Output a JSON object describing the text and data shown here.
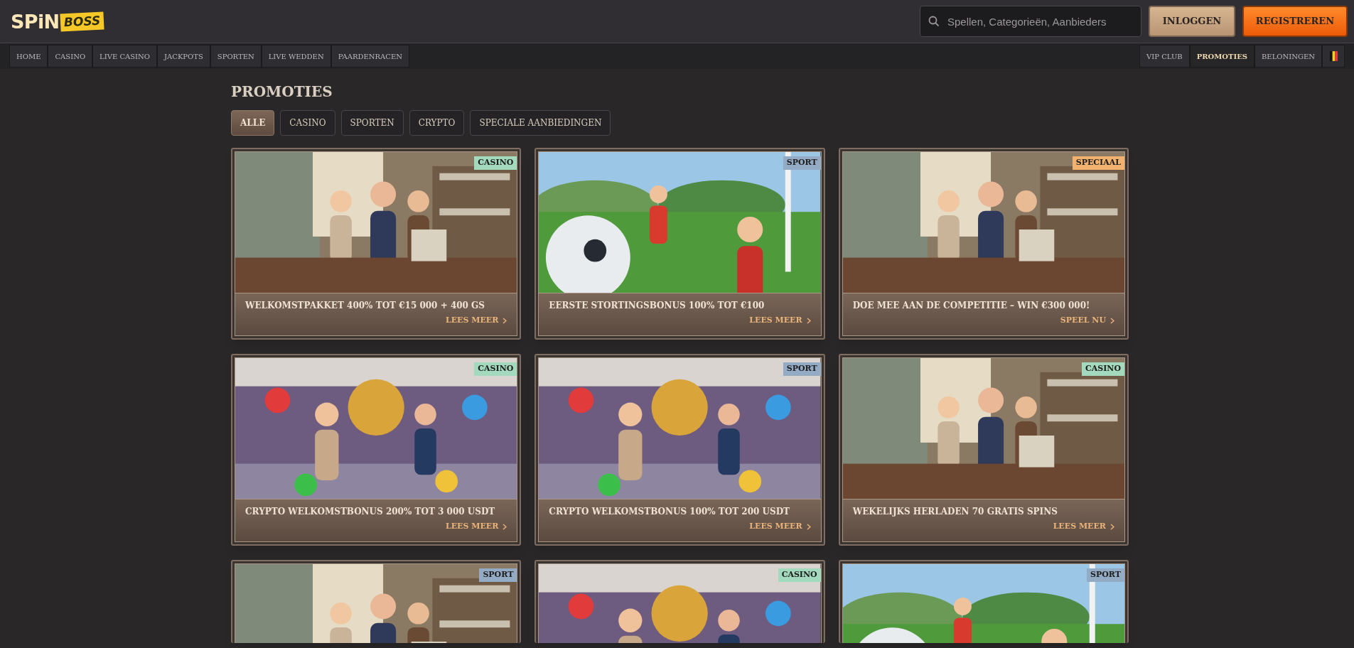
{
  "logo": {
    "text_1": "SPiN",
    "text_2": "BOSS"
  },
  "search": {
    "placeholder": "Spellen, Categorieën, Aanbieders"
  },
  "buttons": [
    {
      "label": "INLOGGEN",
      "kind": "secondary"
    },
    {
      "label": "REGISTREREN",
      "kind": "primary"
    }
  ],
  "main_nav": [
    {
      "label": "HOME"
    },
    {
      "label": "CASINO"
    },
    {
      "label": "LIVE CASINO"
    },
    {
      "label": "JACKPOTS"
    },
    {
      "label": "SPORTEN"
    },
    {
      "label": "LIVE WEDDEN"
    },
    {
      "label": "PAARDENRACEN"
    }
  ],
  "secondary_nav": [
    {
      "label": "VIP CLUB",
      "selected": false
    },
    {
      "label": "PROMOTIES",
      "selected": true
    },
    {
      "label": "BELONINGEN",
      "selected": false
    }
  ],
  "page_title": "PROMOTIES",
  "filters": [
    {
      "label": "ALLE",
      "selected": true
    },
    {
      "label": "CASINO",
      "selected": false
    },
    {
      "label": "SPORTEN",
      "selected": false
    },
    {
      "label": "CRYPTO",
      "selected": false
    },
    {
      "label": "SPECIALE AANBIEDINGEN",
      "selected": false
    }
  ],
  "promotions": [
    {
      "tag": "CASINO",
      "color": "#a3d9bd",
      "title": "WELKOMSTPAKKET 400% TOT €15 000 + 400 GS",
      "link": "LEES MEER"
    },
    {
      "tag": "SPORT",
      "color": "#94abc6",
      "title": "EERSTE STORTINGSBONUS 100% TOT €100",
      "link": "LEES MEER"
    },
    {
      "tag": "SPECIAAL",
      "color": "#f0b26e",
      "title": "DOE MEE AAN DE COMPETITIE – WIN €300 000!",
      "link": "SPEEL NU"
    },
    {
      "tag": "CASINO",
      "color": "#a3d9bd",
      "title": "CRYPTO WELKOMSTBONUS 200% TOT 3 000 USDT",
      "link": "LEES MEER"
    },
    {
      "tag": "SPORT",
      "color": "#94abc6",
      "title": "CRYPTO WELKOMSTBONUS 100% TOT 200 USDT",
      "link": "LEES MEER"
    },
    {
      "tag": "CASINO",
      "color": "#a3d9bd",
      "title": "WEKELIJKS HERLADEN 70 GRATIS SPINS",
      "link": "LEES MEER"
    },
    {
      "tag": "SPORT",
      "color": "#94abc6"
    },
    {
      "tag": "CASINO",
      "color": "#a3d9bd"
    },
    {
      "tag": "SPORT",
      "color": "#94abc6"
    }
  ]
}
